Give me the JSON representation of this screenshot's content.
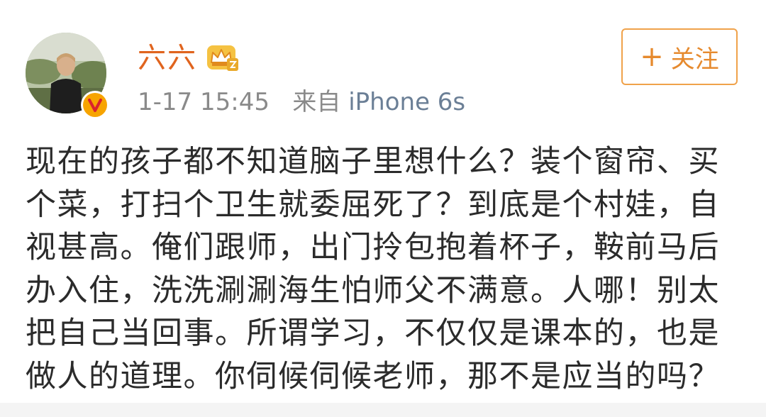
{
  "post": {
    "author": {
      "name": "六六",
      "avatar_icon": "user-avatar",
      "verified_icon": "verified-v-icon",
      "member_icon": "crown-icon"
    },
    "meta": {
      "timestamp": "1-17 15:45",
      "source_prefix": "来自",
      "source_device": "iPhone 6s"
    },
    "follow": {
      "plus": "+",
      "label": "关注"
    },
    "text_lines": [
      "现在的孩子都不知道脑子里想什么？装个窗帘、买",
      "个菜，打扫个卫生就委屈死了？到底是个村娃，自",
      "视甚高。俺们跟师，出门拎包抱着杯子，鞍前马后",
      "办入住，洗洗涮涮海生怕师父不满意。人哪！别太",
      "把自己当回事。所谓学习，不仅仅是课本的，也是",
      "做人的道理。你伺候伺候老师，那不是应当的吗？"
    ]
  },
  "colors": {
    "username": "#e0641e",
    "meta": "#8a8a8a",
    "device": "#6b7f96",
    "follow_accent": "#e68a2e",
    "body_text": "#2b2b2b",
    "verified": "#f7a400"
  }
}
